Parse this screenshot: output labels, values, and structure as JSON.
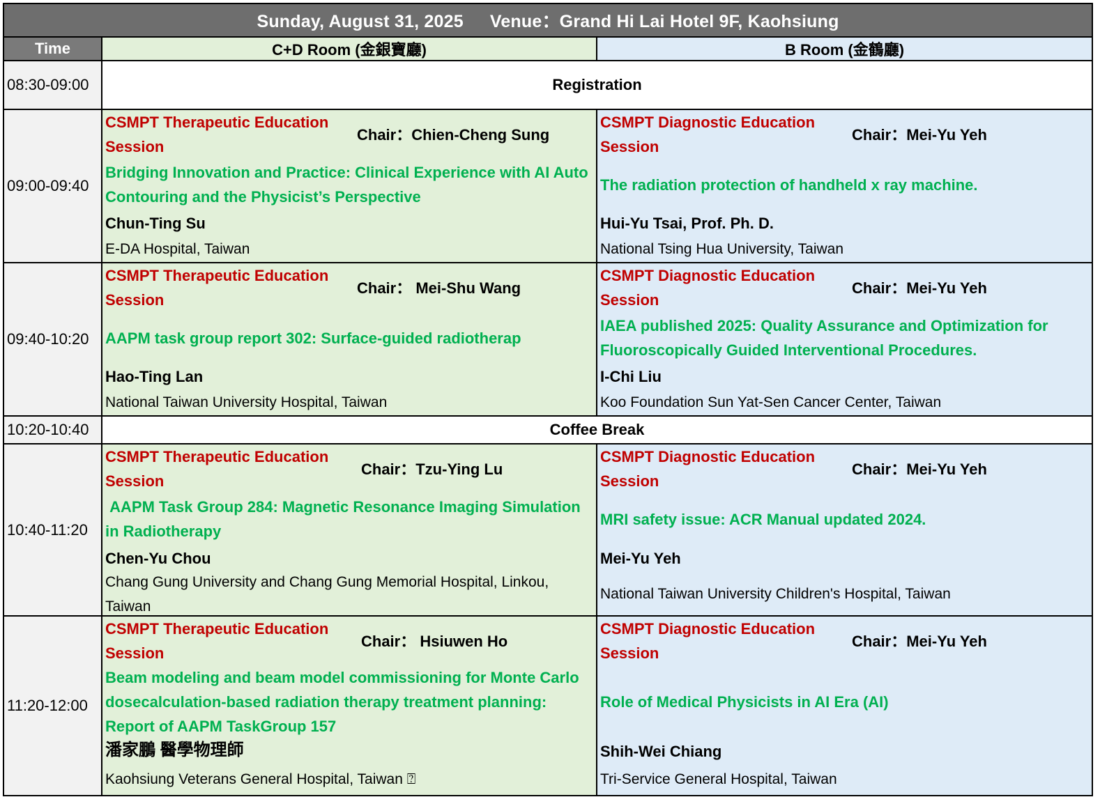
{
  "header": {
    "date": "Sunday, August 31, 2025",
    "venue": "Venue：Grand Hi Lai Hotel 9F, Kaohsiung"
  },
  "columns": {
    "time": "Time",
    "cd_room": "C+D Room (金銀寶廳)",
    "b_room": "B Room (金鶴廳)"
  },
  "rows": [
    {
      "time": "08:30-09:00",
      "label": "Registration"
    },
    {
      "time": "09:00-09:40",
      "cd": {
        "session": "CSMPT  Therapeutic Education Session",
        "chair": "Chair：Chien-Cheng Sung",
        "topic": "Bridging Innovation and Practice: Clinical Experience with AI Auto Contouring and the Physicist’s Perspective",
        "speaker": "Chun-Ting Su",
        "affiliation": "E-DA Hospital, Taiwan"
      },
      "b": {
        "session": "CSMPT Diagnostic Education Session",
        "chair": "Chair：Mei-Yu Yeh",
        "topic": "The radiation protection of handheld x ray machine.",
        "speaker": "Hui-Yu Tsai, Prof. Ph. D.",
        "affiliation": "National Tsing Hua University, Taiwan"
      }
    },
    {
      "time": "09:40-10:20",
      "cd": {
        "session": "CSMPT  Therapeutic Education Session",
        "chair": "Chair：  Mei-Shu Wang",
        "topic": "AAPM task group report 302: Surface-guided radiotherap",
        "speaker": "Hao-Ting Lan",
        "affiliation": "National Taiwan University Hospital, Taiwan"
      },
      "b": {
        "session": "CSMPT Diagnostic Education Session",
        "chair": "Chair：Mei-Yu Yeh",
        "topic": "IAEA published 2025: Quality Assurance and Optimization for Fluoroscopically Guided Interventional Procedures.",
        "speaker": "I-Chi Liu",
        "affiliation": "Koo Foundation Sun Yat-Sen Cancer Center, Taiwan"
      }
    },
    {
      "time": "10:20-10:40",
      "label": "Coffee Break"
    },
    {
      "time": "10:40-11:20",
      "cd": {
        "session": "CSMPT  Therapeutic Education Session",
        "chair": "Chair：Tzu-Ying Lu",
        "topic": " AAPM Task Group 284: Magnetic Resonance Imaging Simulation in Radiotherapy",
        "speaker": "Chen-Yu Chou",
        "affiliation": "Chang Gung University and Chang Gung Memorial Hospital, Linkou, Taiwan"
      },
      "b": {
        "session": "CSMPT Diagnostic Education Session",
        "chair": "Chair：Mei-Yu Yeh",
        "topic": "MRI safety issue: ACR Manual updated 2024.",
        "speaker": "Mei-Yu Yeh",
        "affiliation": "National Taiwan University Children's Hospital, Taiwan"
      }
    },
    {
      "time": "11:20-12:00",
      "cd": {
        "session": "CSMPT  Therapeutic Education Session",
        "chair": "Chair：  Hsiuwen Ho",
        "topic": "Beam modeling and beam model commissioning for Monte Carlo dosecalculation-based radiation therapy treatment planning: Report of AAPM TaskGroup 157",
        "speaker": "潘家鵬 醫學物理師",
        "affiliation": "Kaohsiung Veterans General Hospital, Taiwan ⍰"
      },
      "b": {
        "session": "CSMPT Diagnostic Education Session",
        "chair": "Chair：Mei-Yu Yeh",
        "topic": "Role of Medical Physicists in AI Era (AI)",
        "speaker": "Shih-Wei Chiang",
        "affiliation": "Tri-Service General Hospital, Taiwan"
      }
    }
  ],
  "colors": {
    "title_bg": "#6e6e6e",
    "cd_bg": "#e2f0d9",
    "b_bg": "#deebf7",
    "session_red": "#c00000",
    "topic_green": "#00b050"
  }
}
